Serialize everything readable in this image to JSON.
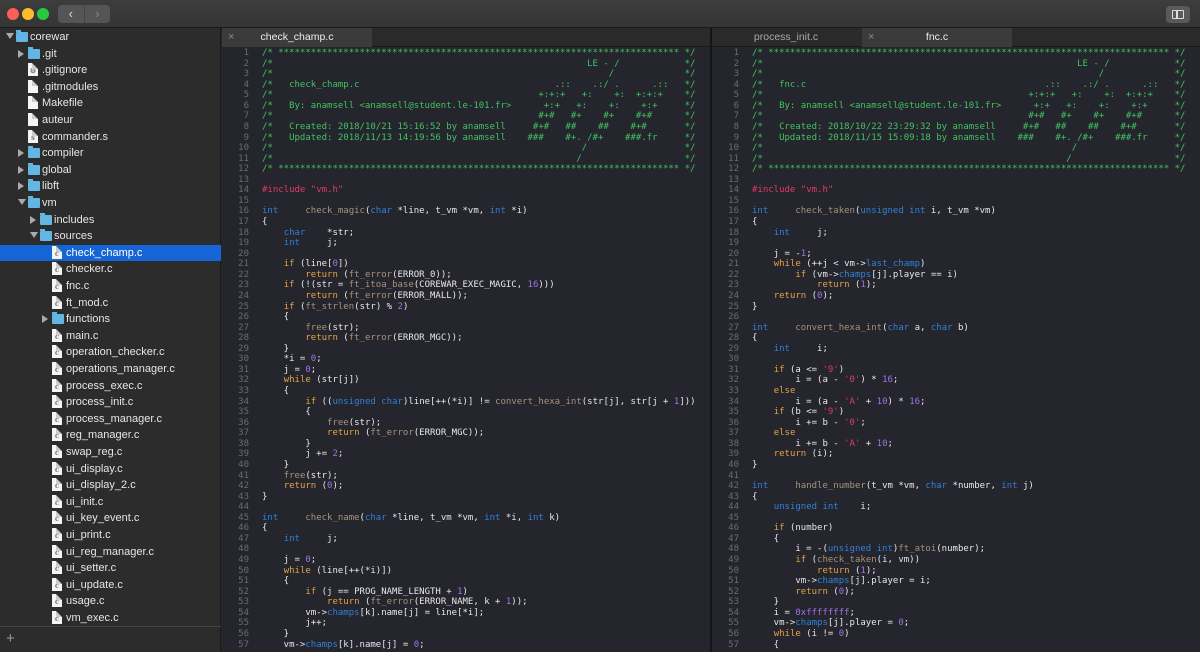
{
  "window": {
    "traffic_lights": {
      "close": "#fc5f57",
      "minimize": "#fdbc2e",
      "zoom": "#28c840"
    },
    "nav_back_icon": "chevron-left-icon",
    "nav_forward_icon": "chevron-right-icon",
    "back_label": "‹",
    "forward_label": "›",
    "sidebar_toggle_icon": "sidebar-icon"
  },
  "sidebar": {
    "items": [
      {
        "label": "corewar",
        "type": "folder",
        "depth": 0,
        "expanded": true
      },
      {
        "label": ".git",
        "type": "folder",
        "depth": 1,
        "expanded": false
      },
      {
        "label": ".gitignore",
        "type": "gitfile",
        "depth": 1
      },
      {
        "label": ".gitmodules",
        "type": "file",
        "depth": 1
      },
      {
        "label": "Makefile",
        "type": "file",
        "depth": 1
      },
      {
        "label": "auteur",
        "type": "file",
        "depth": 1
      },
      {
        "label": "commander.s",
        "type": "sfile",
        "depth": 1
      },
      {
        "label": "compiler",
        "type": "folder",
        "depth": 1,
        "expanded": false
      },
      {
        "label": "global",
        "type": "folder",
        "depth": 1,
        "expanded": false
      },
      {
        "label": "libft",
        "type": "folder",
        "depth": 1,
        "expanded": false
      },
      {
        "label": "vm",
        "type": "folder",
        "depth": 1,
        "expanded": true
      },
      {
        "label": "includes",
        "type": "folder",
        "depth": 2,
        "expanded": false
      },
      {
        "label": "sources",
        "type": "folder",
        "depth": 2,
        "expanded": true
      },
      {
        "label": "check_champ.c",
        "type": "cfile",
        "depth": 3,
        "selected": true
      },
      {
        "label": "checker.c",
        "type": "cfile",
        "depth": 3
      },
      {
        "label": "fnc.c",
        "type": "cfile",
        "depth": 3
      },
      {
        "label": "ft_mod.c",
        "type": "cfile",
        "depth": 3
      },
      {
        "label": "functions",
        "type": "folder",
        "depth": 3,
        "expanded": false
      },
      {
        "label": "main.c",
        "type": "cfile",
        "depth": 3
      },
      {
        "label": "operation_checker.c",
        "type": "cfile",
        "depth": 3
      },
      {
        "label": "operations_manager.c",
        "type": "cfile",
        "depth": 3
      },
      {
        "label": "process_exec.c",
        "type": "cfile",
        "depth": 3
      },
      {
        "label": "process_init.c",
        "type": "cfile",
        "depth": 3
      },
      {
        "label": "process_manager.c",
        "type": "cfile",
        "depth": 3
      },
      {
        "label": "reg_manager.c",
        "type": "cfile",
        "depth": 3
      },
      {
        "label": "swap_reg.c",
        "type": "cfile",
        "depth": 3
      },
      {
        "label": "ui_display.c",
        "type": "cfile",
        "depth": 3
      },
      {
        "label": "ui_display_2.c",
        "type": "cfile",
        "depth": 3
      },
      {
        "label": "ui_init.c",
        "type": "cfile",
        "depth": 3
      },
      {
        "label": "ui_key_event.c",
        "type": "cfile",
        "depth": 3
      },
      {
        "label": "ui_print.c",
        "type": "cfile",
        "depth": 3
      },
      {
        "label": "ui_reg_manager.c",
        "type": "cfile",
        "depth": 3
      },
      {
        "label": "ui_setter.c",
        "type": "cfile",
        "depth": 3
      },
      {
        "label": "ui_update.c",
        "type": "cfile",
        "depth": 3
      },
      {
        "label": "usage.c",
        "type": "cfile",
        "depth": 3
      },
      {
        "label": "vm_exec.c",
        "type": "cfile",
        "depth": 3
      }
    ],
    "add_label": "+",
    "selected_color": "#1565d6"
  },
  "editor": {
    "panes": [
      {
        "tabs": [
          {
            "label": "check_champ.c",
            "active": true,
            "close": "×"
          }
        ],
        "lines": [
          "/* ************************************************************************** */",
          "/*                                                          LE - /            */",
          "/*                                                              /             */",
          "/*   check_champ.c                                    .::    .:/ .      .::   */",
          "/*                                                 +:+:+   +:    +:  +:+:+    */",
          "/*   By: anamsell <anamsell@student.le-101.fr>      +:+   +:    +:    +:+     */",
          "/*                                                 #+#   #+    #+    #+#      */",
          "/*   Created: 2018/10/21 15:16:52 by anamsell     #+#   ##    ##    #+#       */",
          "/*   Updated: 2018/11/13 14:19:56 by anamsell    ###    #+. /#+    ###.fr     */",
          "/*                                                         /                  */",
          "/*                                                        /                   */",
          "/* ************************************************************************** */",
          "",
          "#include \"vm.h\"",
          "",
          "int     check_magic(char *line, t_vm *vm, int *i)",
          "{",
          "    char    *str;",
          "    int     j;",
          "",
          "    if (line[0])",
          "        return (ft_error(ERROR_0));",
          "    if (!(str = ft_itoa_base(COREWAR_EXEC_MAGIC, 16)))",
          "        return (ft_error(ERROR_MALL));",
          "    if (ft_strlen(str) % 2)",
          "    {",
          "        free(str);",
          "        return (ft_error(ERROR_MGC));",
          "    }",
          "    *i = 0;",
          "    j = 0;",
          "    while (str[j])",
          "    {",
          "        if ((unsigned char)line[++(*i)] != convert_hexa_int(str[j], str[j + 1]))",
          "        {",
          "            free(str);",
          "            return (ft_error(ERROR_MGC));",
          "        }",
          "        j += 2;",
          "    }",
          "    free(str);",
          "    return (0);",
          "}",
          "",
          "int     check_name(char *line, t_vm *vm, int *i, int k)",
          "{",
          "    int     j;",
          "",
          "    j = 0;",
          "    while (line[++(*i)])",
          "    {",
          "        if (j == PROG_NAME_LENGTH + 1)",
          "            return (ft_error(ERROR_NAME, k + 1));",
          "        vm->champs[k].name[j] = line[*i];",
          "        j++;",
          "    }",
          "    vm->champs[k].name[j] = 0;"
        ]
      },
      {
        "tabs": [
          {
            "label": "process_init.c",
            "active": false
          },
          {
            "label": "fnc.c",
            "active": true,
            "close": "×"
          }
        ],
        "lines": [
          "/* ************************************************************************** */",
          "/*                                                          LE - /            */",
          "/*                                                              /             */",
          "/*   fnc.c                                            .::    .:/ .      .::   */",
          "/*                                                 +:+:+   +:    +:  +:+:+    */",
          "/*   By: anamsell <anamsell@student.le-101.fr>      +:+   +:    +:    +:+     */",
          "/*                                                 #+#   #+    #+    #+#      */",
          "/*   Created: 2018/10/22 23:29:32 by anamsell     #+#   ##    ##    #+#       */",
          "/*   Updated: 2018/11/15 15:09:18 by anamsell    ###    #+. /#+    ###.fr     */",
          "/*                                                         /                  */",
          "/*                                                        /                   */",
          "/* ************************************************************************** */",
          "",
          "#include \"vm.h\"",
          "",
          "int     check_taken(unsigned int i, t_vm *vm)",
          "{",
          "    int     j;",
          "",
          "    j = -1;",
          "    while (++j < vm->last_champ)",
          "        if (vm->champs[j].player == i)",
          "            return (1);",
          "    return (0);",
          "}",
          "",
          "int     convert_hexa_int(char a, char b)",
          "{",
          "    int     i;",
          "",
          "    if (a <= '9')",
          "        i = (a - '0') * 16;",
          "    else",
          "        i = (a - 'A' + 10) * 16;",
          "    if (b <= '9')",
          "        i += b - '0';",
          "    else",
          "        i += b - 'A' + 10;",
          "    return (i);",
          "}",
          "",
          "int     handle_number(t_vm *vm, char *number, int j)",
          "{",
          "    unsigned int    i;",
          "",
          "    if (number)",
          "    {",
          "        i = -(unsigned int)ft_atoi(number);",
          "        if (check_taken(i, vm))",
          "            return (1);",
          "        vm->champs[j].player = i;",
          "        return (0);",
          "    }",
          "    i = 0xffffffff;",
          "    vm->champs[j].player = 0;",
          "    while (i != 0)",
          "    {"
        ]
      }
    ],
    "syntax_colors": {
      "comment": "#41c35f",
      "type": "#2f82d6",
      "control": "#e2a443",
      "function": "#a8927a",
      "number": "#a273e6",
      "preprocessor": "#e23a62",
      "text": "#e8e8e8"
    }
  }
}
